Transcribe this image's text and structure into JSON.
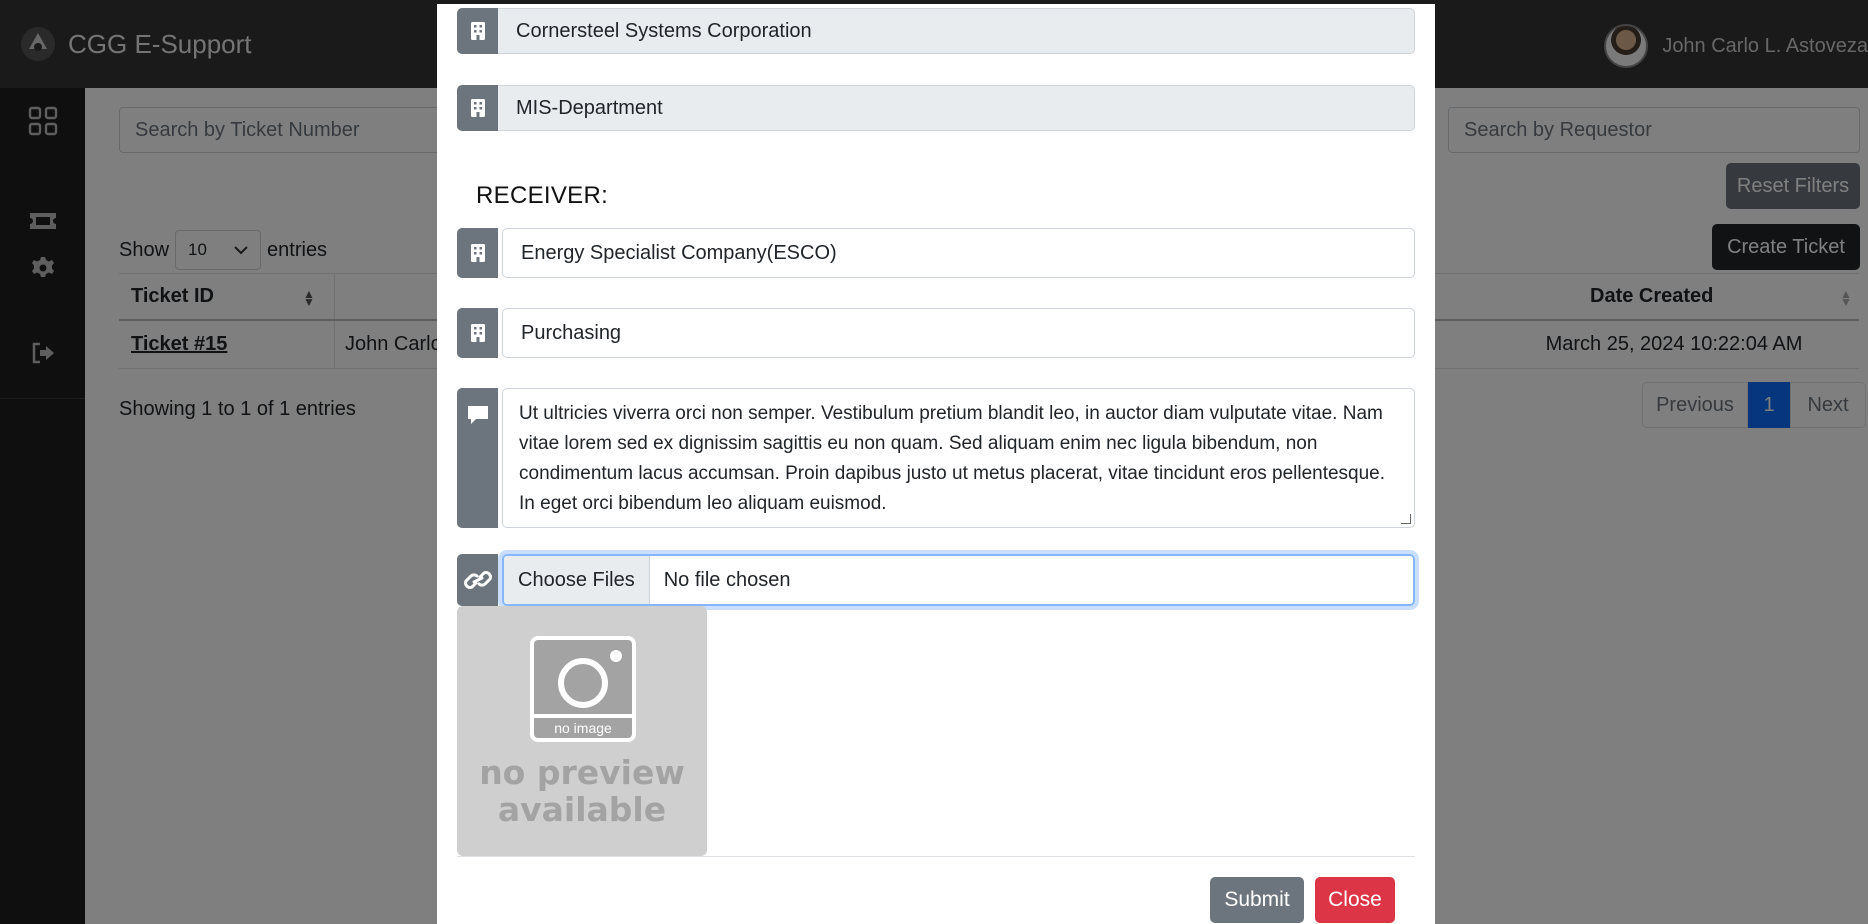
{
  "app": {
    "brand": "CGG E-Support",
    "user_name": "John Carlo L. Astoveza"
  },
  "sidebar": {
    "icons": [
      "dashboard-icon",
      "ticket-icon",
      "gear-icon",
      "logout-icon"
    ]
  },
  "filters": {
    "ticket_search_placeholder": "Search by Ticket Number",
    "requestor_search_placeholder": "Search by Requestor",
    "reset_label": "Reset Filters",
    "create_label": "Create Ticket"
  },
  "table": {
    "show_label": "Show",
    "page_size": "10",
    "entries_label": "entries",
    "columns": {
      "ticket_id": "Ticket ID",
      "date_created": "Date Created"
    },
    "rows": [
      {
        "ticket": "Ticket #15",
        "requestor": "John Carlo",
        "date": "March 25, 2024 10:22:04 AM"
      }
    ],
    "info": "Showing 1 to 1 of 1 entries"
  },
  "pagination": {
    "previous": "Previous",
    "current": "1",
    "next": "Next"
  },
  "modal": {
    "sender_company": "Cornersteel Systems Corporation",
    "sender_department": "MIS-Department",
    "receiver_title": "RECEIVER:",
    "receiver_company": "Energy Specialist Company(ESCO)",
    "receiver_department": "Purchasing",
    "message": "Ut ultricies viverra orci non semper. Vestibulum pretium blandit leo, in auctor diam vulputate vitae. Nam vitae lorem sed ex dignissim sagittis eu non quam. Sed aliquam enim nec ligula bibendum, non condimentum lacus accumsan. Proin dapibus justo ut metus placerat, vitae tincidunt eros pellentesque. In eget orci bibendum leo aliquam euismod.",
    "file_button": "Choose Files",
    "file_status": "No file chosen",
    "preview_badge": "no image",
    "preview_text": "no preview available",
    "submit_label": "Submit",
    "close_label": "Close"
  },
  "colors": {
    "topbar": "#343434",
    "sidebar": "#1f1f1f",
    "icon_addon": "#6c757d",
    "primary": "#0d6efd",
    "danger": "#dc3545",
    "secondary": "#6c757d",
    "dark": "#212529"
  }
}
